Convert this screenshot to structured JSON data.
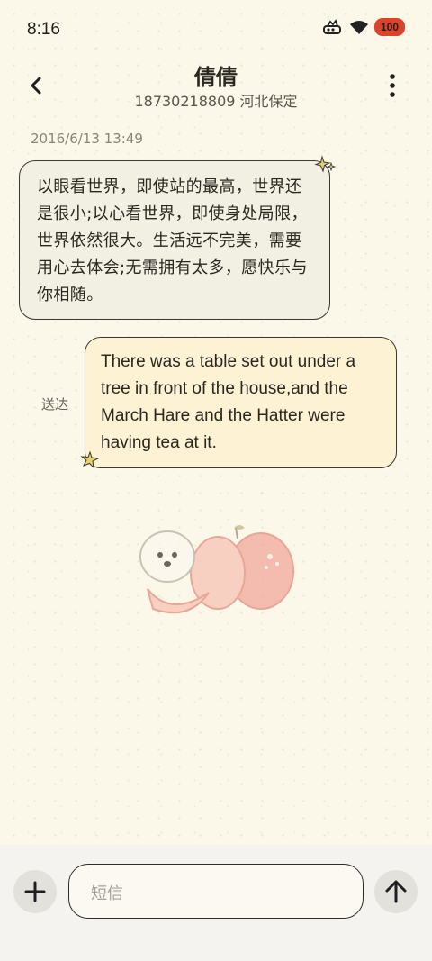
{
  "status": {
    "time": "8:16",
    "battery": "100"
  },
  "header": {
    "name": "倩倩",
    "info": "18730218809 河北保定"
  },
  "thread": {
    "timestamp": "2016/6/13 13:49",
    "incoming": "以眼看世界，即使站的最高，世界还是很小;以心看世界，即使身处局限，世界依然很大。生活远不完美，需要用心去体会;无需拥有太多，愿快乐与你相随。",
    "outgoing": "There was a table set out under a tree in front of the house,and the March Hare and the Hatter were having tea at it.",
    "outgoing_status": "送达"
  },
  "composer": {
    "placeholder": "短信"
  },
  "icons": {
    "back": "chevron-left-icon",
    "more": "more-vertical-icon",
    "add": "plus-icon",
    "send": "arrow-up-icon",
    "signal": "signal-icon",
    "wifi": "wifi-icon",
    "battery": "battery-icon"
  }
}
